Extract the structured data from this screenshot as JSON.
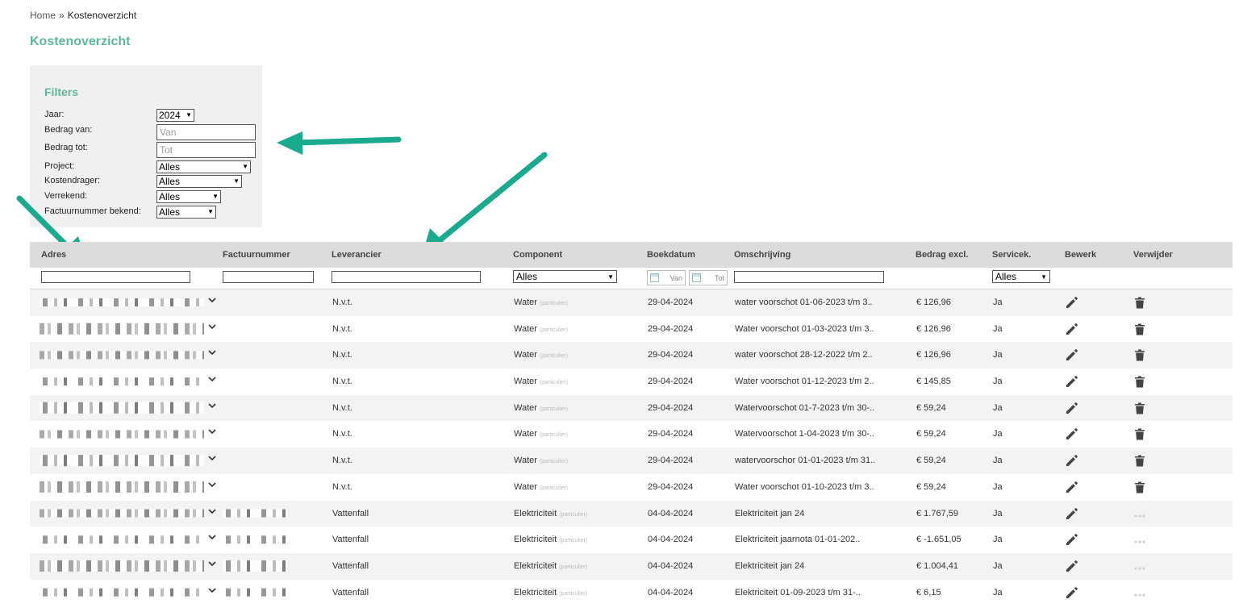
{
  "breadcrumb": {
    "home": "Home",
    "separator": "»",
    "current": "Kostenoverzicht"
  },
  "page_title": "Kostenoverzicht",
  "filters": {
    "title": "Filters",
    "jaar": {
      "label": "Jaar:",
      "value": "2024"
    },
    "bedrag_van": {
      "label": "Bedrag van:",
      "placeholder": "Van"
    },
    "bedrag_tot": {
      "label": "Bedrag tot:",
      "placeholder": "Tot"
    },
    "project": {
      "label": "Project:",
      "value": "Alles"
    },
    "kostendrager": {
      "label": "Kostendrager:",
      "value": "Alles"
    },
    "verrekend": {
      "label": "Verrekend:",
      "value": "Alles"
    },
    "factuurnummer_bekend": {
      "label": "Factuurnummer bekend:",
      "value": "Alles"
    }
  },
  "table": {
    "headers": {
      "adres": "Adres",
      "factuurnummer": "Factuurnummer",
      "leverancier": "Leverancier",
      "component": "Component",
      "boekdatum": "Boekdatum",
      "omschrijving": "Omschrijving",
      "bedrag": "Bedrag excl.",
      "servicek": "Servicek.",
      "bewerk": "Bewerk",
      "verwijder": "Verwijder"
    },
    "filter_row": {
      "component_value": "Alles",
      "date_van": "Van",
      "date_tot": "Tot",
      "servicek_value": "Alles"
    },
    "component_tag": "(particulier)",
    "rows": [
      {
        "leverancier": "N.v.t.",
        "component": "Water",
        "boekdatum": "29-04-2024",
        "omschrijving": "water voorschot 01-06-2023 t/m 3..",
        "bedrag": "€ 126,96",
        "servicek": "Ja",
        "deletable": true
      },
      {
        "leverancier": "N.v.t.",
        "component": "Water",
        "boekdatum": "29-04-2024",
        "omschrijving": "Water voorschot 01-03-2023 t/m 3..",
        "bedrag": "€ 126,96",
        "servicek": "Ja",
        "deletable": true
      },
      {
        "leverancier": "N.v.t.",
        "component": "Water",
        "boekdatum": "29-04-2024",
        "omschrijving": "water voorschot 28-12-2022 t/m 2..",
        "bedrag": "€ 126,96",
        "servicek": "Ja",
        "deletable": true
      },
      {
        "leverancier": "N.v.t.",
        "component": "Water",
        "boekdatum": "29-04-2024",
        "omschrijving": "Water voorschot 01-12-2023 t/m 2..",
        "bedrag": "€ 145,85",
        "servicek": "Ja",
        "deletable": true
      },
      {
        "leverancier": "N.v.t.",
        "component": "Water",
        "boekdatum": "29-04-2024",
        "omschrijving": "Watervoorschot 01-7-2023 t/m 30-..",
        "bedrag": "€ 59,24",
        "servicek": "Ja",
        "deletable": true
      },
      {
        "leverancier": "N.v.t.",
        "component": "Water",
        "boekdatum": "29-04-2024",
        "omschrijving": "Watervoorschot 1-04-2023 t/m 30-..",
        "bedrag": "€ 59,24",
        "servicek": "Ja",
        "deletable": true
      },
      {
        "leverancier": "N.v.t.",
        "component": "Water",
        "boekdatum": "29-04-2024",
        "omschrijving": "watervoorschor 01-01-2023 t/m 31..",
        "bedrag": "€ 59,24",
        "servicek": "Ja",
        "deletable": true
      },
      {
        "leverancier": "N.v.t.",
        "component": "Water",
        "boekdatum": "29-04-2024",
        "omschrijving": "Water voorschot 01-10-2023 t/m 3..",
        "bedrag": "€ 59,24",
        "servicek": "Ja",
        "deletable": true
      },
      {
        "leverancier": "Vattenfall",
        "component": "Elektriciteit",
        "boekdatum": "04-04-2024",
        "omschrijving": "Elektriciteit jan 24",
        "bedrag": "€ 1.767,59",
        "servicek": "Ja",
        "deletable": false
      },
      {
        "leverancier": "Vattenfall",
        "component": "Elektriciteit",
        "boekdatum": "04-04-2024",
        "omschrijving": "Elektriciteit jaarnota 01-01-202..",
        "bedrag": "€ -1.651,05",
        "servicek": "Ja",
        "deletable": false
      },
      {
        "leverancier": "Vattenfall",
        "component": "Elektriciteit",
        "boekdatum": "04-04-2024",
        "omschrijving": "Elektriciteit jan 24",
        "bedrag": "€ 1.004,41",
        "servicek": "Ja",
        "deletable": false
      },
      {
        "leverancier": "Vattenfall",
        "component": "Elektriciteit",
        "boekdatum": "04-04-2024",
        "omschrijving": "Elektriciteit 01-09-2023 t/m 31-..",
        "bedrag": "€ 6,15",
        "servicek": "Ja",
        "deletable": false
      }
    ]
  },
  "icons": {
    "edit": "pencil-icon",
    "delete": "trash-icon",
    "disabled_delete": "more-dots-icon",
    "expand": "chevron-down-icon"
  },
  "colors": {
    "accent": "#5cb89a",
    "header_bg": "#dcdcdc",
    "arrow": "#1aab8f"
  }
}
